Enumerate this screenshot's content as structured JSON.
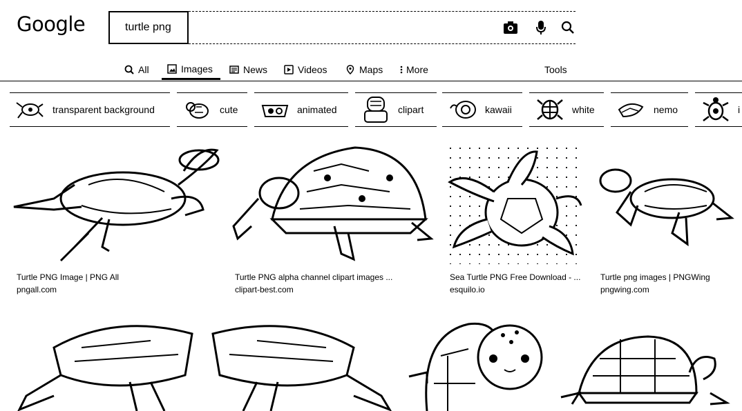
{
  "header": {
    "logo": "Google",
    "search_value": "turtle png",
    "icons": [
      "camera-icon",
      "mic-icon",
      "search-icon"
    ]
  },
  "tabs": [
    {
      "label": "All",
      "icon": "search-icon"
    },
    {
      "label": "Images",
      "icon": "image-icon",
      "active": true
    },
    {
      "label": "News",
      "icon": "news-icon"
    },
    {
      "label": "Videos",
      "icon": "play-icon"
    },
    {
      "label": "Maps",
      "icon": "pin-icon"
    },
    {
      "label": "More",
      "icon": "more-vert-icon"
    }
  ],
  "tools_label": "Tools",
  "chips": [
    {
      "label": "transparent background"
    },
    {
      "label": "cute"
    },
    {
      "label": "animated"
    },
    {
      "label": "clipart"
    },
    {
      "label": "kawaii"
    },
    {
      "label": "white"
    },
    {
      "label": "nemo"
    },
    {
      "label": "i"
    }
  ],
  "results": [
    {
      "title": "Turtle PNG Image | PNG All",
      "source": "pngall.com"
    },
    {
      "title": "Turtle PNG alpha channel clipart images ...",
      "source": "clipart-best.com"
    },
    {
      "title": "Sea Turtle PNG Free Download - ...",
      "source": "esquilo.io"
    },
    {
      "title": "Turtle png images | PNGWing",
      "source": "pngwing.com"
    }
  ]
}
